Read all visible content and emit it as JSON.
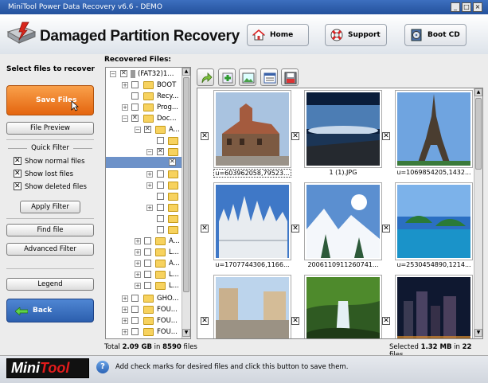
{
  "window": {
    "title": "MiniTool Power Data Recovery v6.6 - DEMO"
  },
  "header": {
    "app_title": "Damaged Partition Recovery",
    "home_label": "Home",
    "support_label": "Support",
    "bootcd_label": "Boot CD"
  },
  "left": {
    "select_label": "Select files to recover",
    "save_files": "Save Files",
    "file_preview": "File Preview",
    "quick_filter": "Quick Filter",
    "show_normal": "Show normal files",
    "show_lost": "Show lost files",
    "show_deleted": "Show deleted files",
    "apply_filter": "Apply Filter",
    "find_file": "Find file",
    "advanced_filter": "Advanced Filter",
    "legend": "Legend",
    "back": "Back"
  },
  "recovered_label": "Recovered Files:",
  "tree": {
    "rows": [
      {
        "label": "(FAT32)1..."
      },
      {
        "label": "BOOT"
      },
      {
        "label": "Recy..."
      },
      {
        "label": "Prog..."
      },
      {
        "label": "Doc..."
      },
      {
        "label": "A..."
      },
      {
        "label": ""
      },
      {
        "label": ""
      },
      {
        "label": ""
      },
      {
        "label": ""
      },
      {
        "label": ""
      },
      {
        "label": ""
      },
      {
        "label": ""
      },
      {
        "label": ""
      },
      {
        "label": ""
      },
      {
        "label": "A..."
      },
      {
        "label": "L..."
      },
      {
        "label": "A..."
      },
      {
        "label": "L..."
      },
      {
        "label": "L..."
      },
      {
        "label": "GHO..."
      },
      {
        "label": "FOU..."
      },
      {
        "label": "FOU..."
      },
      {
        "label": "FOU..."
      }
    ]
  },
  "gallery": {
    "items": [
      {
        "caption": "u=603962058,79523..."
      },
      {
        "caption": "1 (1).JPG"
      },
      {
        "caption": "u=1069854205,1432..."
      },
      {
        "caption": "u=1707744306,1166..."
      },
      {
        "caption": "2006110911260741..."
      },
      {
        "caption": "u=2530454890,1214..."
      },
      {
        "caption": ""
      },
      {
        "caption": ""
      },
      {
        "caption": ""
      }
    ]
  },
  "status": {
    "total_prefix": "Total",
    "total_size": "2.09 GB",
    "total_in": "in",
    "total_count": "8590",
    "total_suffix": "files",
    "selected_prefix": "Selected",
    "selected_size": "1.32 MB",
    "selected_in": "in",
    "selected_count": "22",
    "selected_suffix": "files."
  },
  "footer": {
    "logo_mini": "Mini",
    "logo_tool": "Tool",
    "help_text": "Add check marks for desired files and click this button to save them."
  },
  "colors": {
    "accent_orange": "#e4650f",
    "accent_blue": "#2c5fae",
    "title_bar": "#23519c"
  },
  "icons": [
    "home-icon",
    "support-lifebuoy-icon",
    "boot-cd-icon",
    "hard-drive-icon",
    "cursor-icon",
    "back-arrow-icon",
    "help-icon"
  ]
}
